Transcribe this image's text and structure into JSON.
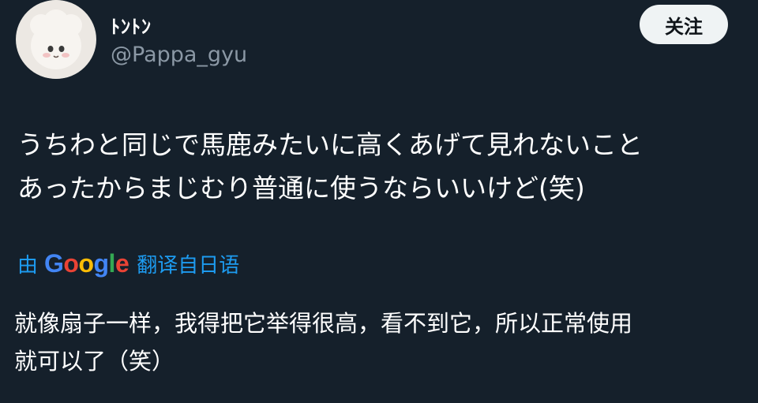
{
  "tweet": {
    "display_name": "ﾄﾝﾄﾝ",
    "handle": "@Pappa_gyu",
    "follow_label": "关注",
    "text": "うちわと同じで馬鹿みたいに高くあげて見れないこと\nあったからまじむり普通に使うならいいけど(笑)",
    "translation": {
      "prefix": "由",
      "brand": [
        "G",
        "o",
        "o",
        "g",
        "l",
        "e"
      ],
      "brand_colors": [
        "#4285f4",
        "#ea4335",
        "#fbbc05",
        "#4285f4",
        "#34a853",
        "#ea4335"
      ],
      "suffix": "翻译自日语",
      "text": "就像扇子一样，我得把它举得很高，看不到它，所以正常使用\n就可以了（笑）"
    }
  },
  "colors": {
    "background": "#15202b",
    "link": "#1d9bf0",
    "secondary_text": "#8b98a5",
    "follow_bg": "#eff3f4"
  },
  "icons": {
    "avatar": "avatar-plush-figure"
  }
}
